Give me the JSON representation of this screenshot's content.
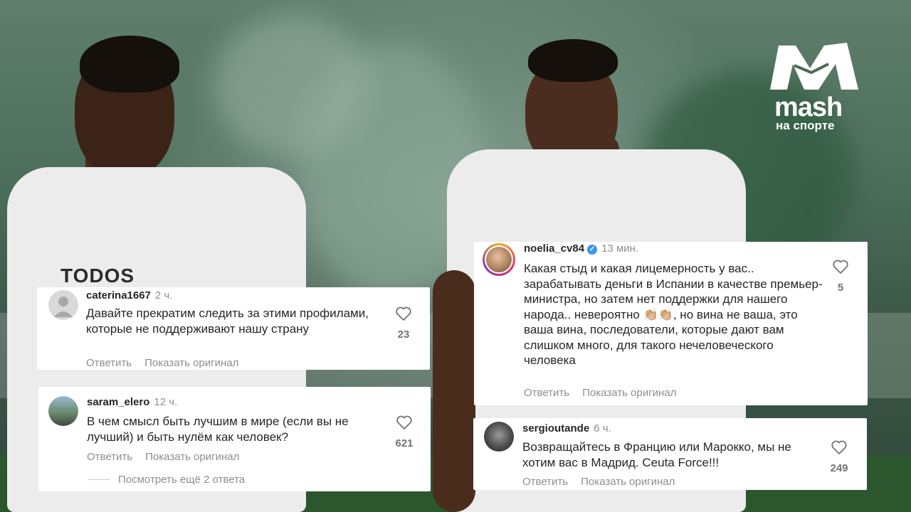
{
  "brand": {
    "word": "mash",
    "sub": "на спорте"
  },
  "photo": {
    "shirt_text": "TODOS SOMOS"
  },
  "comments": [
    {
      "username": "caterina1667",
      "time": "2 ч.",
      "text": "Давайте прекратим следить за этими профилами, которые не поддерживают нашу страну",
      "likes": "23",
      "reply": "Ответить",
      "original": "Показать оригинал"
    },
    {
      "username": "saram_elero",
      "time": "12 ч.",
      "text": "В чем смысл быть лучшим в мире (если вы не лучший) и быть нулём как человек?",
      "likes": "621",
      "reply": "Ответить",
      "original": "Показать оригинал",
      "more_replies": "Посмотреть ещё 2 ответа"
    },
    {
      "username": "noelia_cv84",
      "verified": true,
      "time": "13 мин.",
      "text": "Какая стыд и какая лицемерность у вас.. зарабатывать деньги в Испании в качестве премьер-министра, но затем нет поддержки для нашего народа.. невероятно 👏🏼👏🏼, но вина не ваша, это ваша вина, последователи, которые дают вам слишком много, для такого нечеловеческого человека",
      "likes": "5",
      "reply": "Ответить",
      "original": "Показать оригинал"
    },
    {
      "username": "sergioutande",
      "time": "6 ч.",
      "text": "Возвращайтесь в Францию или Марокко, мы не хотим вас в Мадрид. Ceuta Force!!!",
      "likes": "249",
      "reply": "Ответить",
      "original": "Показать оригинал"
    }
  ],
  "colors": {
    "card_bg": "#ffffff",
    "text": "#262626",
    "muted": "#8e8e8e",
    "verified": "#3897f0"
  }
}
